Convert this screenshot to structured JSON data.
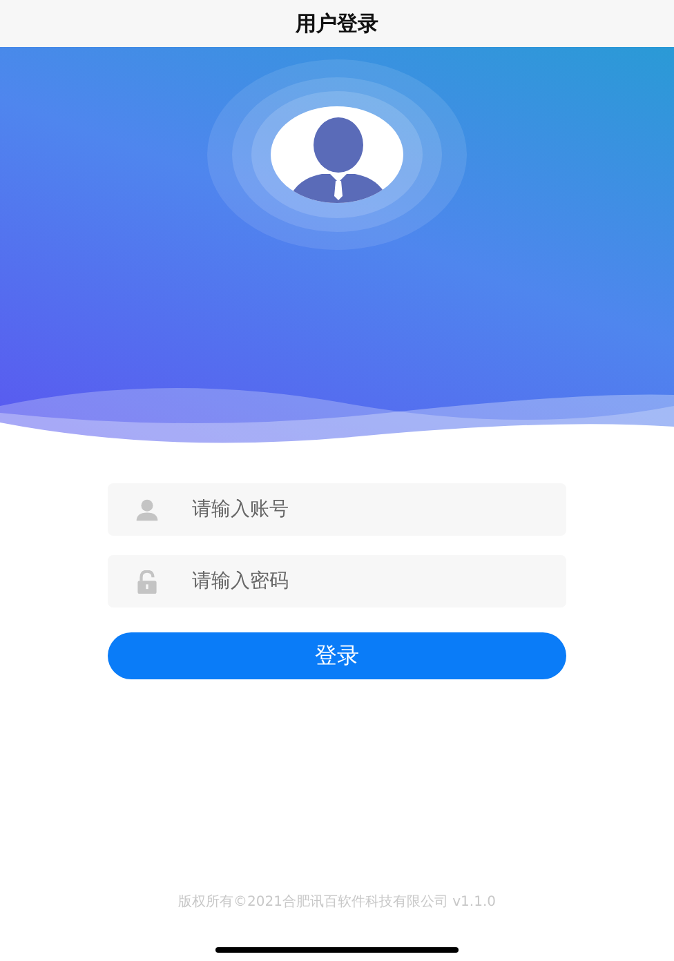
{
  "header": {
    "title": "用户登录"
  },
  "form": {
    "fields": [
      {
        "kind": "account",
        "placeholder": "请输入账号"
      },
      {
        "kind": "password",
        "placeholder": "请输入密码"
      }
    ],
    "submit": "登录"
  },
  "footer": {
    "copyright": "版权所有©2021合肥讯百软件科技有限公司 v1.1.0"
  }
}
